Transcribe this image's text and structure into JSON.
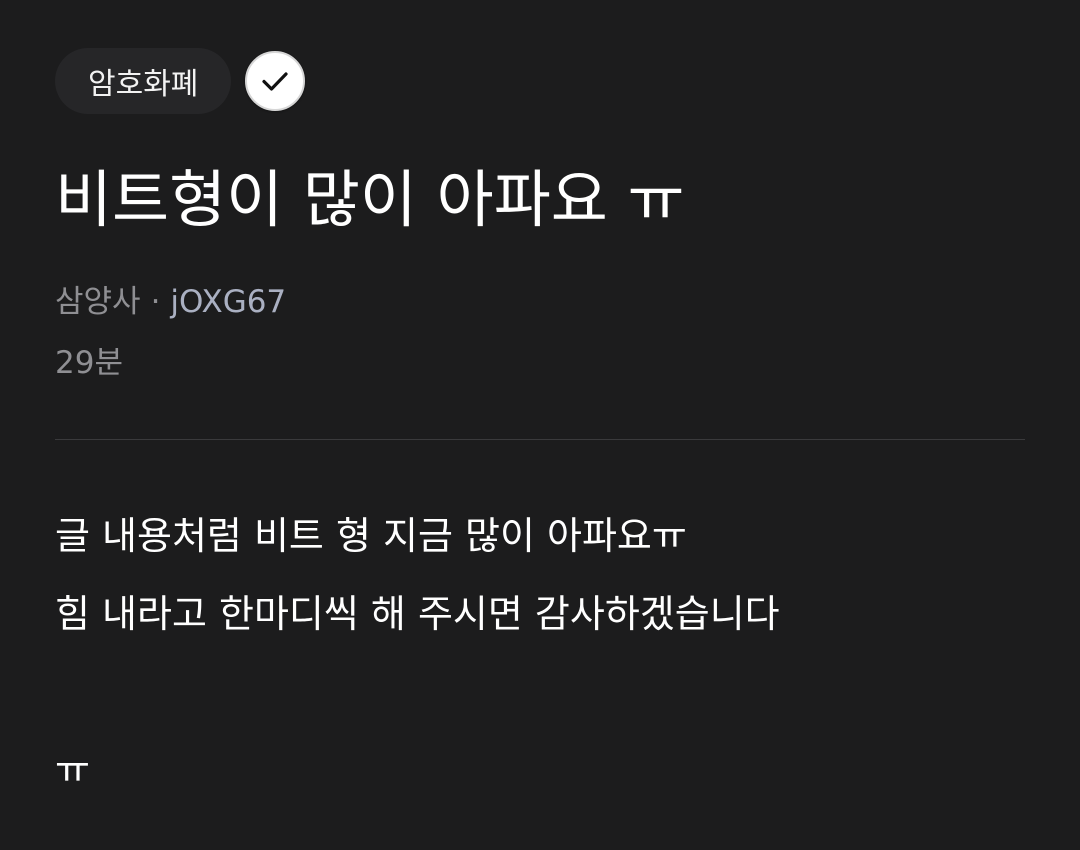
{
  "post": {
    "category": "암호화폐",
    "title": "비트형이 많이 아파요 ㅠ",
    "company": "삼양사",
    "separator": "·",
    "author": "jOXG67",
    "time": "29분",
    "body": {
      "line1": "글 내용처럼 비트 형 지금 많이 아파요ㅠ",
      "line2": "힘 내라고 한마디씩 해 주시면 감사하겠습니다",
      "line3": "ㅠ"
    }
  },
  "icons": {
    "verified": "checkmark-icon"
  },
  "colors": {
    "background": "#1c1c1d",
    "chip": "#262628",
    "meta_gray": "#8f8f93",
    "author": "#aab0c2",
    "divider": "#3a3a3c"
  }
}
